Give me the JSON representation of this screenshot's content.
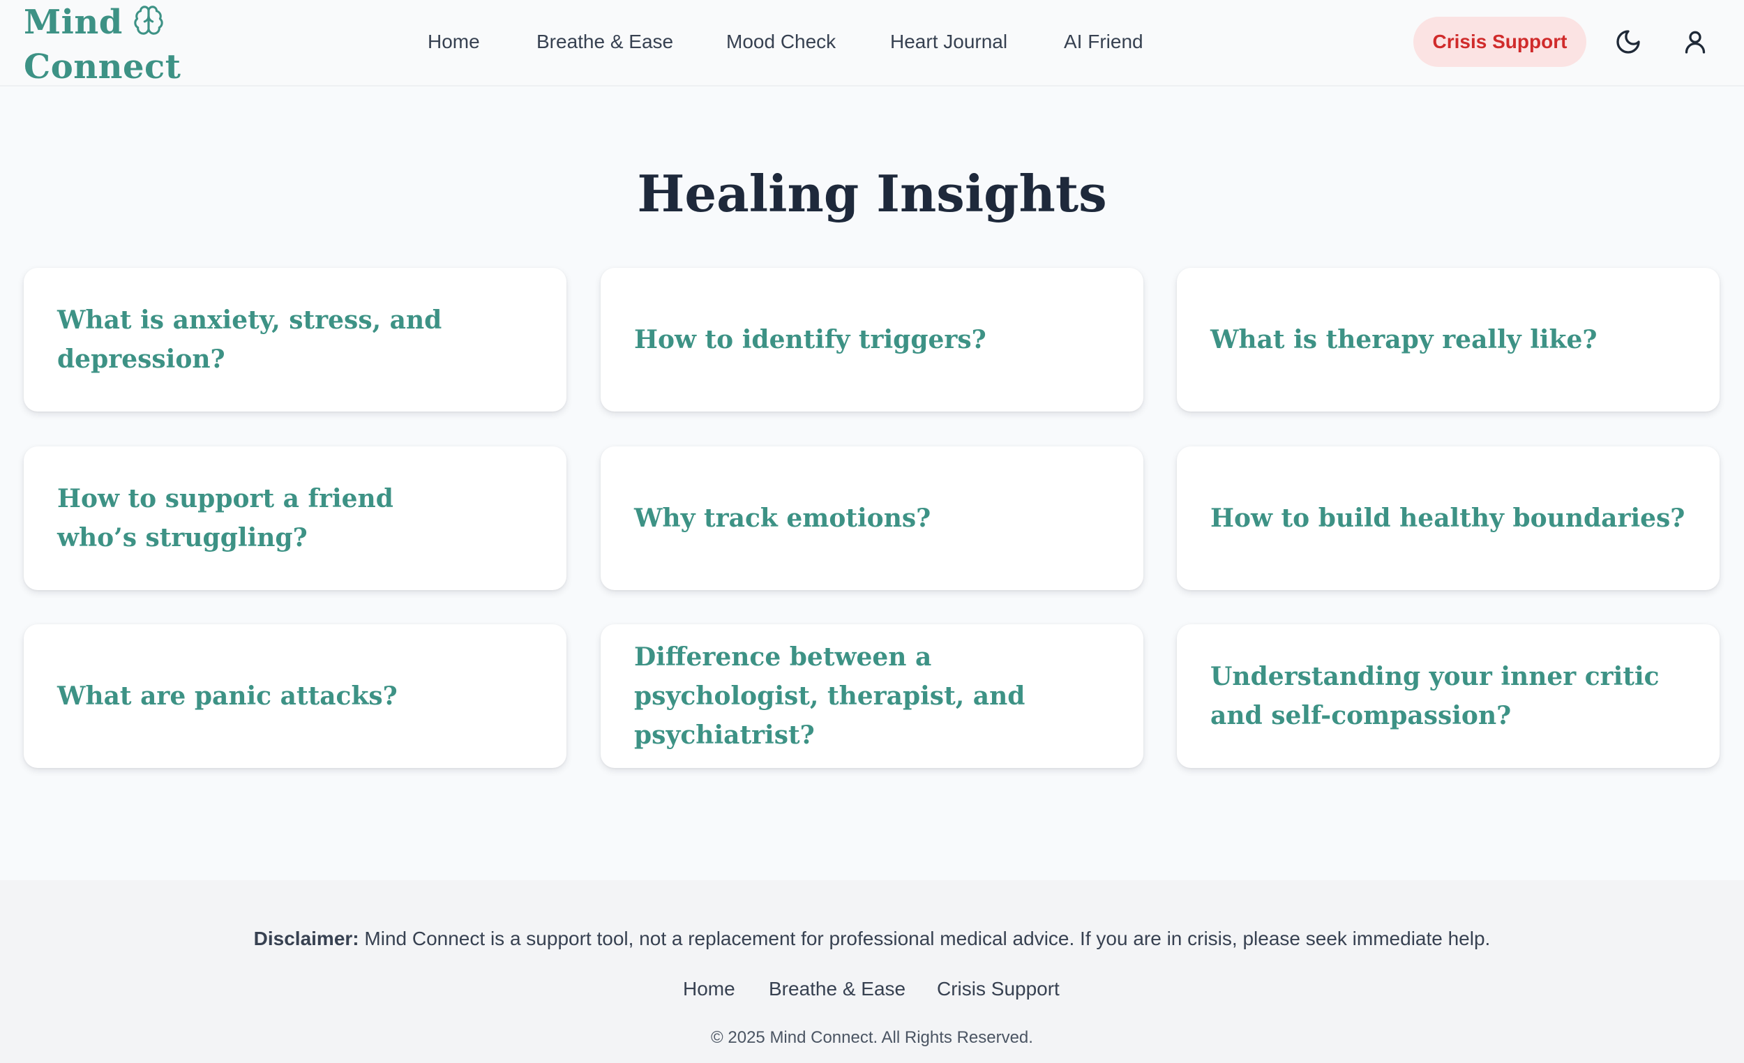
{
  "brand": {
    "name_line1": "Mind",
    "name_line2": "Connect",
    "icon": "brain-icon",
    "color": "#3d9285"
  },
  "nav": {
    "items": [
      {
        "label": "Home"
      },
      {
        "label": "Breathe & Ease"
      },
      {
        "label": "Mood Check"
      },
      {
        "label": "Heart Journal"
      },
      {
        "label": "AI Friend"
      }
    ],
    "crisis_label": "Crisis Support",
    "theme_icon": "moon-icon",
    "profile_icon": "user-icon"
  },
  "main": {
    "title": "Healing Insights",
    "cards": [
      {
        "title": "What is anxiety, stress, and depression?"
      },
      {
        "title": "How to identify triggers?"
      },
      {
        "title": "What is therapy really like?"
      },
      {
        "title": "How to support a friend who’s struggling?"
      },
      {
        "title": "Why track emotions?"
      },
      {
        "title": "How to build healthy boundaries?"
      },
      {
        "title": "What are panic attacks?"
      },
      {
        "title": "Difference between a psychologist, therapist, and psychiatrist?"
      },
      {
        "title": "Understanding your inner critic and self-compassion?"
      }
    ]
  },
  "footer": {
    "disclaimer_label": "Disclaimer:",
    "disclaimer_text": " Mind Connect is a support tool, not a replacement for professional medical advice. If you are in crisis, please seek immediate help.",
    "links": [
      {
        "label": "Home"
      },
      {
        "label": "Breathe & Ease"
      },
      {
        "label": "Crisis Support"
      }
    ],
    "copyright": "© 2025 Mind Connect. All Rights Reserved."
  },
  "colors": {
    "accent": "#3d9285",
    "crisis_bg": "#fbe3e3",
    "crisis_text": "#d02b2b",
    "page_bg": "#f8fafc",
    "footer_bg": "#f3f4f6"
  }
}
